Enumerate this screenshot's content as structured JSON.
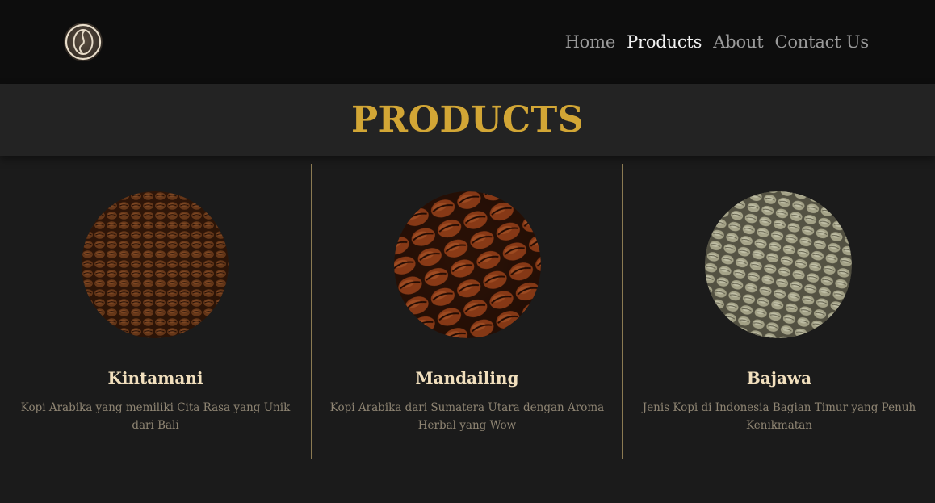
{
  "nav": {
    "logo_icon": "coffee-bean-logo-icon",
    "items": [
      {
        "label": "Home",
        "active": false
      },
      {
        "label": "Products",
        "active": true
      },
      {
        "label": "About",
        "active": false
      },
      {
        "label": "Contact Us",
        "active": false
      }
    ]
  },
  "header": {
    "title": "PRODUCTS"
  },
  "products": [
    {
      "name": "Kintamani",
      "description": "Kopi Arabika yang memiliki Cita Rasa yang Unik dari Bali",
      "image": "roasted-beans-photo"
    },
    {
      "name": "Mandailing",
      "description": "Kopi Arabika dari Sumatera Utara dengan Aroma Herbal yang Wow",
      "image": "large-roasted-beans-photo"
    },
    {
      "name": "Bajawa",
      "description": "Jenis Kopi di Indonesia Bagian Timur yang Penuh Kenikmatan",
      "image": "green-beans-photo"
    }
  ],
  "colors": {
    "accent": "#d2a635",
    "background": "#1b1b1b",
    "navbar": "#0d0d0d",
    "divider": "#8b7a52"
  }
}
